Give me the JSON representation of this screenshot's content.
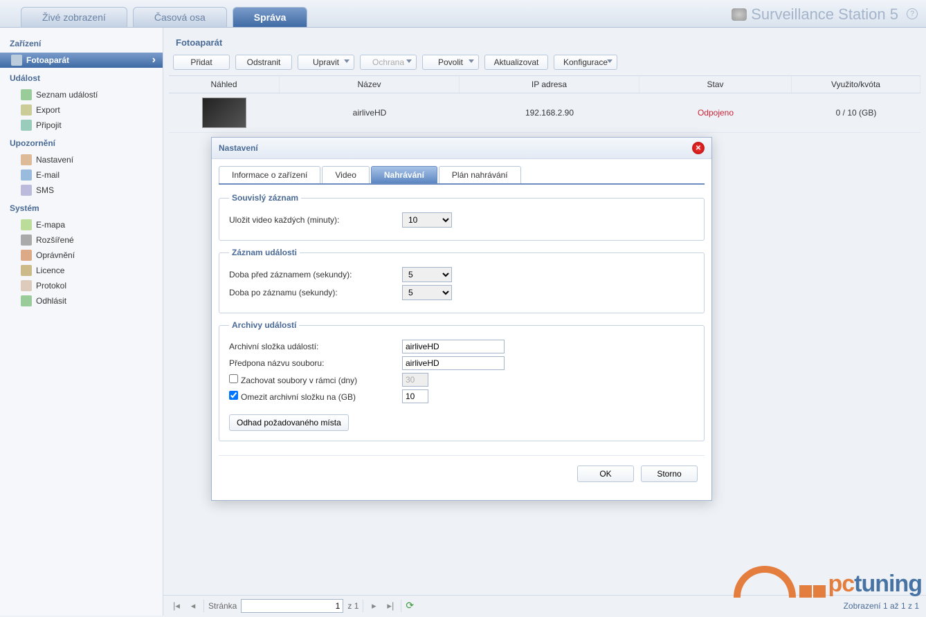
{
  "header": {
    "tabs": [
      "Živé zobrazení",
      "Časová osa",
      "Správa"
    ],
    "active_tab": 2,
    "app_title": "Surveillance Station 5"
  },
  "sidebar": {
    "groups": [
      {
        "title": "Zařízení",
        "items": [
          "Fotoaparát"
        ],
        "active": 0
      },
      {
        "title": "Událost",
        "items": [
          "Seznam událostí",
          "Export",
          "Připojit"
        ]
      },
      {
        "title": "Upozornění",
        "items": [
          "Nastavení",
          "E-mail",
          "SMS"
        ]
      },
      {
        "title": "Systém",
        "items": [
          "E-mapa",
          "Rozšířené",
          "Oprávnění",
          "Licence",
          "Protokol",
          "Odhlásit"
        ]
      }
    ]
  },
  "panel": {
    "title": "Fotoaparát",
    "toolbar": [
      "Přidat",
      "Odstranit",
      "Upravit",
      "Ochrana",
      "Povolit",
      "Aktualizovat",
      "Konfigurace"
    ],
    "columns": [
      "Náhled",
      "Název",
      "IP adresa",
      "Stav",
      "Využito/kvóta"
    ],
    "row": {
      "name": "airliveHD",
      "ip": "192.168.2.90",
      "state": "Odpojeno",
      "quota": "0 / 10 (GB)"
    }
  },
  "modal": {
    "title": "Nastavení",
    "tabs": [
      "Informace o zařízení",
      "Video",
      "Nahrávání",
      "Plán nahrávání"
    ],
    "active_tab": 2,
    "continuous": {
      "legend": "Souvislý záznam",
      "label": "Uložit video každých (minuty):",
      "value": "10"
    },
    "event_rec": {
      "legend": "Záznam události",
      "pre_label": "Doba před záznamem (sekundy):",
      "pre_value": "5",
      "post_label": "Doba po záznamu (sekundy):",
      "post_value": "5"
    },
    "archives": {
      "legend": "Archivy událostí",
      "folder_label": "Archivní složka událostí:",
      "folder_value": "airliveHD",
      "prefix_label": "Předpona názvu souboru:",
      "prefix_value": "airliveHD",
      "keep_label": "Zachovat soubory v rámci (dny)",
      "keep_value": "30",
      "keep_checked": false,
      "limit_label": "Omezit archivní složku na (GB)",
      "limit_value": "10",
      "limit_checked": true,
      "estimate_btn": "Odhad požadovaného místa"
    },
    "ok": "OK",
    "cancel": "Storno"
  },
  "pager": {
    "page_label": "Stránka",
    "page": "1",
    "of_label": "z 1",
    "summary": "Zobrazení 1 až 1 z 1"
  },
  "watermark": "pctuning"
}
